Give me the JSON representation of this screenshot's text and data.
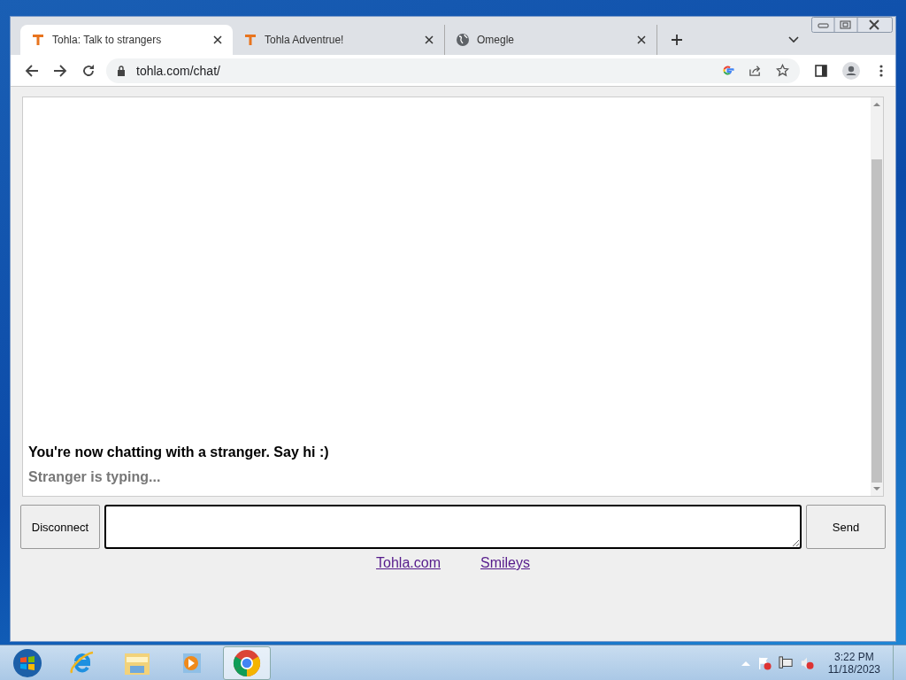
{
  "tabs": [
    {
      "title": "Tohla: Talk to strangers",
      "kind": "tohla",
      "selected": true
    },
    {
      "title": "Tohla Adventrue!",
      "kind": "tohla",
      "selected": false
    },
    {
      "title": "Omegle",
      "kind": "generic",
      "selected": false
    }
  ],
  "address": "tohla.com/chat/",
  "log": [
    {
      "kind": "system",
      "text": "You're now chatting with a stranger. Say hi :)"
    },
    {
      "kind": "status",
      "text": "Stranger is typing..."
    }
  ],
  "disconnect_button": "Disconnect",
  "send_button": "Send",
  "footer_links": [
    "Tohla.com",
    "Smileys"
  ],
  "taskbar": {
    "apps": [
      {
        "kind": "start",
        "selected": false
      },
      {
        "kind": "ie",
        "selected": false
      },
      {
        "kind": "explorer",
        "selected": false
      },
      {
        "kind": "media",
        "selected": false
      },
      {
        "kind": "chrome",
        "selected": true
      }
    ],
    "clock": {
      "time": "3:22 PM",
      "date": "11/18/2023"
    }
  }
}
